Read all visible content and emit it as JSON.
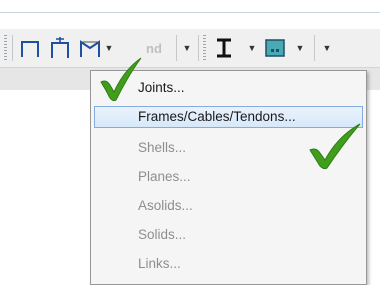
{
  "toolbar": {
    "disabled_button_text": "nd",
    "dropdown_arrow": "▼"
  },
  "menu": {
    "items": [
      {
        "label": "Joints...",
        "enabled": true,
        "highlighted": false
      },
      {
        "label": "Frames/Cables/Tendons...",
        "enabled": true,
        "highlighted": true
      },
      {
        "label": "Shells...",
        "enabled": false,
        "highlighted": false
      },
      {
        "label": "Planes...",
        "enabled": false,
        "highlighted": false
      },
      {
        "label": "Asolids...",
        "enabled": false,
        "highlighted": false
      },
      {
        "label": "Solids...",
        "enabled": false,
        "highlighted": false
      },
      {
        "label": "Links...",
        "enabled": false,
        "highlighted": false
      }
    ]
  },
  "colors": {
    "checkmark": "#3f9f1c",
    "menu_highlight_border": "#84acdd",
    "icon_blue": "#1f4fa0"
  },
  "icons": [
    "portal-frame-icon",
    "portal-frame-hinged-icon",
    "frame-deformed-icon",
    "i-beam-icon",
    "section-display-icon",
    "checkmark-icon"
  ]
}
